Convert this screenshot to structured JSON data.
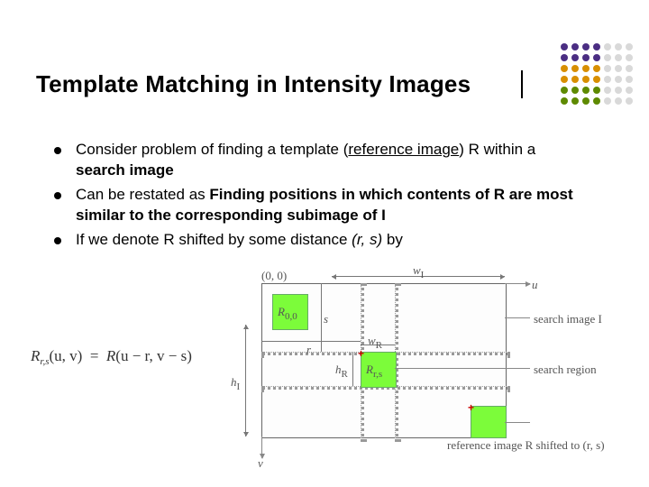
{
  "title": "Template Matching in Intensity Images",
  "bullets": [
    {
      "prefix": "Consider problem of finding a template (",
      "underline": "reference image",
      "suffix": ") R within a ",
      "bold": "search image",
      "tail": ""
    },
    {
      "plain_before": "Can be restated as ",
      "bold": "Finding positions in which contents of R are most similar to the corresponding subimage of I",
      "plain_after": ""
    },
    {
      "plain_before": "If we denote R shifted by some distance ",
      "italic": "(r, s)",
      "plain_after": " by"
    }
  ],
  "formula": {
    "lhs": "R",
    "lhs_sub": "r,s",
    "args": "(u, v)",
    "rhs": "R",
    "rhs_args": "(u − r, v − s)"
  },
  "diagram": {
    "origin": "(0, 0)",
    "u": "u",
    "v": "v",
    "wI": "w",
    "wI_sub": "I",
    "hI": "h",
    "hI_sub": "I",
    "wR": "w",
    "wR_sub": "R",
    "hR": "h",
    "hR_sub": "R",
    "r": "r",
    "s": "s",
    "R00": "R",
    "R00_sub": "0,0",
    "Rrs": "R",
    "Rrs_sub": "r,s",
    "ann_searchimg": "search image I",
    "ann_region": "search region",
    "ann_shift": "reference image R shifted to (r, s)"
  }
}
